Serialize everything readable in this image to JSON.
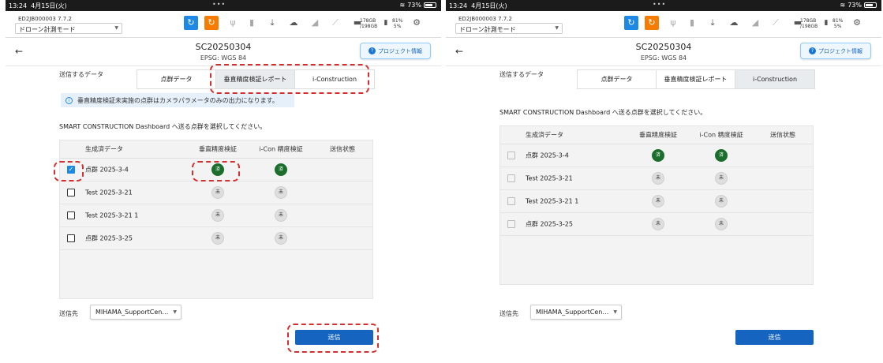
{
  "panels": [
    {
      "status": {
        "time": "13:24",
        "date": "4月15日(火)",
        "dots": "•••",
        "battery": "73%",
        "battery_fraction": 0.73
      },
      "topbar": {
        "device_id": "ED2JB000003   7.7.2",
        "mode": "ドローン計測モード",
        "storage_line1": "178GB",
        "storage_line2": "/198GB",
        "battery_line1": "81%",
        "battery_line2": "5%",
        "icons": [
          "refresh-icon",
          "refresh-icon",
          "usb-icon",
          "sd-card-icon",
          "download-icon",
          "cloud-icon",
          "signal-icon",
          "wrench-icon",
          "laptop-icon",
          "battery-icon",
          "gear-icon"
        ]
      },
      "header": {
        "title": "SC20250304",
        "subtitle": "EPSG: WGS 84",
        "info_button": "プロジェクト情報"
      },
      "send_data_label": "送信するデータ",
      "tabs": [
        {
          "label": "点群データ"
        },
        {
          "label": "垂直精度検証レポート"
        },
        {
          "label": "i-Construction"
        }
      ],
      "active_tab": 1,
      "notice": "垂直精度検証未実施の点群はカメラパラメータのみの出力になります。",
      "instruction": "SMART CONSTRUCTION Dashboard へ送る点群を選択してください。",
      "table": {
        "headers": [
          "生成済データ",
          "垂直精度検証",
          "i-Con 精度検証",
          "送信状態"
        ],
        "rows": [
          {
            "name": "点群 2025-3-4",
            "vertical": "済",
            "icon": "済",
            "status": "",
            "checked": true,
            "enabled": true
          },
          {
            "name": "Test 2025-3-21",
            "vertical": "未",
            "icon": "未",
            "status": "",
            "checked": false,
            "enabled": true
          },
          {
            "name": "Test 2025-3-21 1",
            "vertical": "未",
            "icon": "未",
            "status": "",
            "checked": false,
            "enabled": true
          },
          {
            "name": "点群 2025-3-25",
            "vertical": "未",
            "icon": "未",
            "status": "",
            "checked": false,
            "enabled": true
          }
        ]
      },
      "destination_label": "送信先",
      "destination": "MIHAMA_SupportCen…",
      "send_button": "送信",
      "colors": {
        "accent": "#1e88e5",
        "done_badge": "#1b6e2b",
        "send_button": "#1565c0",
        "highlight": "#d32f2f"
      }
    },
    {
      "status": {
        "time": "13:24",
        "date": "4月15日(火)",
        "dots": "•••",
        "battery": "73%",
        "battery_fraction": 0.73
      },
      "topbar": {
        "device_id": "ED2JB000003   7.7.2",
        "mode": "ドローン計測モード",
        "storage_line1": "178GB",
        "storage_line2": "/198GB",
        "battery_line1": "81%",
        "battery_line2": "5%",
        "icons": [
          "refresh-icon",
          "refresh-icon",
          "usb-icon",
          "sd-card-icon",
          "download-icon",
          "cloud-icon",
          "signal-icon",
          "wrench-icon",
          "laptop-icon",
          "battery-icon",
          "gear-icon"
        ]
      },
      "header": {
        "title": "SC20250304",
        "subtitle": "EPSG: WGS 84",
        "info_button": "プロジェクト情報"
      },
      "send_data_label": "送信するデータ",
      "tabs": [
        {
          "label": "点群データ"
        },
        {
          "label": "垂直精度検証レポート"
        },
        {
          "label": "i-Construction"
        }
      ],
      "active_tab": 2,
      "notice": "",
      "instruction": "SMART CONSTRUCTION Dashboard へ送る点群を選択してください。",
      "table": {
        "headers": [
          "生成済データ",
          "垂直精度検証",
          "i-Con 精度検証",
          "送信状態"
        ],
        "rows": [
          {
            "name": "点群 2025-3-4",
            "vertical": "済",
            "icon": "済",
            "status": "",
            "checked": false,
            "enabled": false
          },
          {
            "name": "Test 2025-3-21",
            "vertical": "未",
            "icon": "未",
            "status": "",
            "checked": false,
            "enabled": false
          },
          {
            "name": "Test 2025-3-21 1",
            "vertical": "未",
            "icon": "未",
            "status": "",
            "checked": false,
            "enabled": false
          },
          {
            "name": "点群 2025-3-25",
            "vertical": "未",
            "icon": "未",
            "status": "",
            "checked": false,
            "enabled": false
          }
        ]
      },
      "destination_label": "送信先",
      "destination": "MIHAMA_SupportCen…",
      "send_button": "送信",
      "colors": {
        "accent": "#1e88e5",
        "done_badge": "#1b6e2b",
        "send_button": "#1565c0"
      }
    }
  ]
}
